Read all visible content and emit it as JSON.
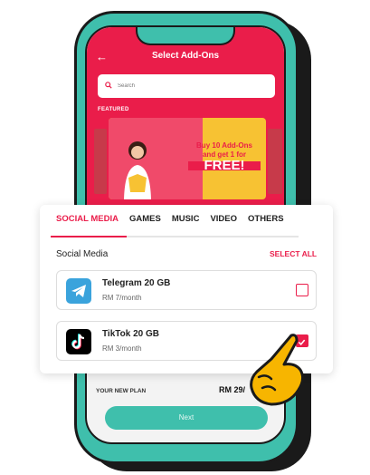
{
  "header": {
    "title": "Select Add-Ons"
  },
  "search": {
    "placeholder": "Search"
  },
  "featured_label": "FEATURED",
  "banner": {
    "line1": "Buy 10 Add-Ons",
    "line2": "and get 1 for",
    "free": "FREE!"
  },
  "tabs": [
    {
      "label": "SOCIAL MEDIA",
      "active": true
    },
    {
      "label": "GAMES"
    },
    {
      "label": "MUSIC"
    },
    {
      "label": "VIDEO"
    },
    {
      "label": "OTHERS"
    }
  ],
  "section": {
    "title": "Social Media",
    "select_all": "SELECT ALL"
  },
  "items": [
    {
      "name": "Telegram 20 GB",
      "price": "RM 7/month",
      "icon": "telegram-icon",
      "checked": false
    },
    {
      "name": "TikTok 20 GB",
      "price": "RM 3/month",
      "icon": "tiktok-icon",
      "checked": true
    }
  ],
  "plan": {
    "label": "YOUR NEW PLAN",
    "price": "RM 29/"
  },
  "next_label": "Next",
  "colors": {
    "primary": "#ea1d4a",
    "teal": "#3fbfac"
  }
}
